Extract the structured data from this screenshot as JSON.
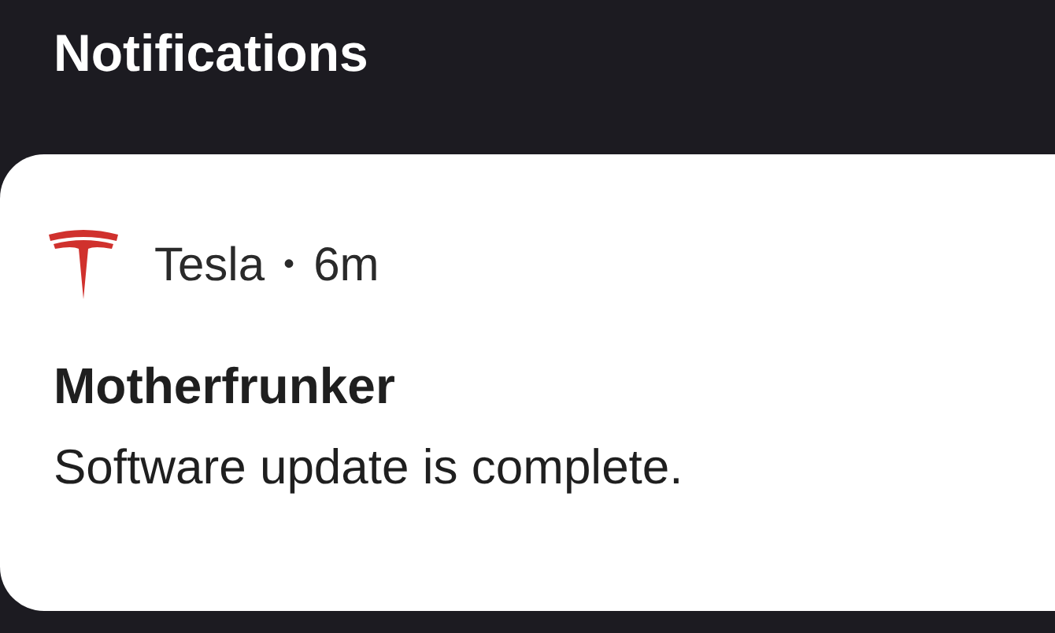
{
  "header": {
    "title": "Notifications"
  },
  "notifications": [
    {
      "app": "Tesla",
      "separator": "•",
      "time": "6m",
      "title": "Motherfrunker",
      "body": "Software update is complete."
    }
  ]
}
